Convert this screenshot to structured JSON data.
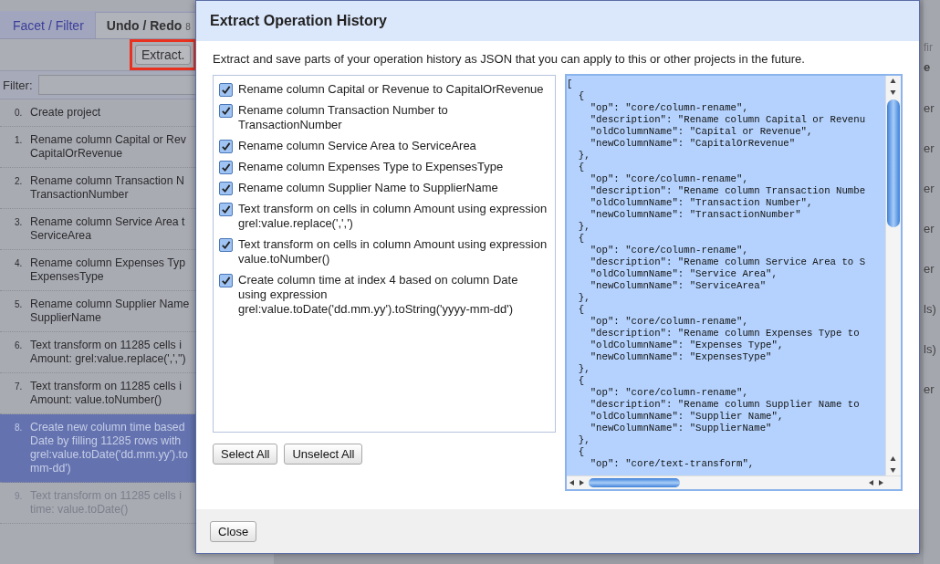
{
  "background": {
    "tabs": [
      {
        "label": "Facet / Filter",
        "selected": false
      },
      {
        "label": "Undo / Redo",
        "count": "8",
        "selected": true
      }
    ],
    "extract_button": {
      "label": "Extract.",
      "highlighted": true
    },
    "filter": {
      "label": "Filter:"
    },
    "history": [
      {
        "number": "0.",
        "lines": [
          "Create project"
        ],
        "selected": false,
        "disabled": false
      },
      {
        "number": "1.",
        "lines": [
          "Rename column Capital or Rev",
          "CapitalOrRevenue"
        ],
        "selected": false,
        "disabled": false
      },
      {
        "number": "2.",
        "lines": [
          "Rename column Transaction N",
          "TransactionNumber"
        ],
        "selected": false,
        "disabled": false
      },
      {
        "number": "3.",
        "lines": [
          "Rename column Service Area t",
          "ServiceArea"
        ],
        "selected": false,
        "disabled": false
      },
      {
        "number": "4.",
        "lines": [
          "Rename column Expenses Typ",
          "ExpensesType"
        ],
        "selected": false,
        "disabled": false
      },
      {
        "number": "5.",
        "lines": [
          "Rename column Supplier Name",
          "SupplierName"
        ],
        "selected": false,
        "disabled": false
      },
      {
        "number": "6.",
        "lines": [
          "Text transform on 11285 cells i",
          "Amount: grel:value.replace(',','')"
        ],
        "selected": false,
        "disabled": false
      },
      {
        "number": "7.",
        "lines": [
          "Text transform on 11285 cells i",
          "Amount: value.toNumber()"
        ],
        "selected": false,
        "disabled": false
      },
      {
        "number": "8.",
        "lines": [
          "Create new column time based",
          "Date by filling 11285 rows with",
          "grel:value.toDate('dd.mm.yy').to",
          "mm-dd')"
        ],
        "selected": true,
        "disabled": false
      },
      {
        "number": "9.",
        "lines": [
          "Text transform on 11285 cells i",
          "time: value.toDate()"
        ],
        "selected": false,
        "disabled": true
      }
    ],
    "right_edge": {
      "search_placeholder": "fir",
      "column_header": "e",
      "cells": [
        "er",
        "er",
        "er",
        "er",
        "er",
        "ls)",
        "ls)",
        "er"
      ]
    }
  },
  "dialog": {
    "title": "Extract Operation History",
    "description": "Extract and save parts of your operation history as JSON that you can apply to this or other projects in the future.",
    "operations": [
      {
        "label": "Rename column Capital or Revenue to CapitalOrRevenue",
        "checked": true
      },
      {
        "label": "Rename column Transaction Number to TransactionNumber",
        "checked": true
      },
      {
        "label": "Rename column Service Area to ServiceArea",
        "checked": true
      },
      {
        "label": "Rename column Expenses Type to ExpensesType",
        "checked": true
      },
      {
        "label": "Rename column Supplier Name to SupplierName",
        "checked": true
      },
      {
        "label": "Text transform on cells in column Amount using expression grel:value.replace(',',')",
        "checked": true
      },
      {
        "label": "Text transform on cells in column Amount using expression value.toNumber()",
        "checked": true
      },
      {
        "label": "Create column time at index 4 based on column Date using expression grel:value.toDate('dd.mm.yy').toString('yyyy-mm-dd')",
        "checked": true
      }
    ],
    "json_lines": [
      "[",
      "  {",
      "    \"op\": \"core/column-rename\",",
      "    \"description\": \"Rename column Capital or Revenu",
      "    \"oldColumnName\": \"Capital or Revenue\",",
      "    \"newColumnName\": \"CapitalOrRevenue\"",
      "  },",
      "  {",
      "    \"op\": \"core/column-rename\",",
      "    \"description\": \"Rename column Transaction Numbe",
      "    \"oldColumnName\": \"Transaction Number\",",
      "    \"newColumnName\": \"TransactionNumber\"",
      "  },",
      "  {",
      "    \"op\": \"core/column-rename\",",
      "    \"description\": \"Rename column Service Area to S",
      "    \"oldColumnName\": \"Service Area\",",
      "    \"newColumnName\": \"ServiceArea\"",
      "  },",
      "  {",
      "    \"op\": \"core/column-rename\",",
      "    \"description\": \"Rename column Expenses Type to",
      "    \"oldColumnName\": \"Expenses Type\",",
      "    \"newColumnName\": \"ExpensesType\"",
      "  },",
      "  {",
      "    \"op\": \"core/column-rename\",",
      "    \"description\": \"Rename column Supplier Name to",
      "    \"oldColumnName\": \"Supplier Name\",",
      "    \"newColumnName\": \"SupplierName\"",
      "  },",
      "  {",
      "    \"op\": \"core/text-transform\","
    ],
    "buttons": [
      "Select All",
      "Unselect All"
    ],
    "close_button": "Close"
  }
}
